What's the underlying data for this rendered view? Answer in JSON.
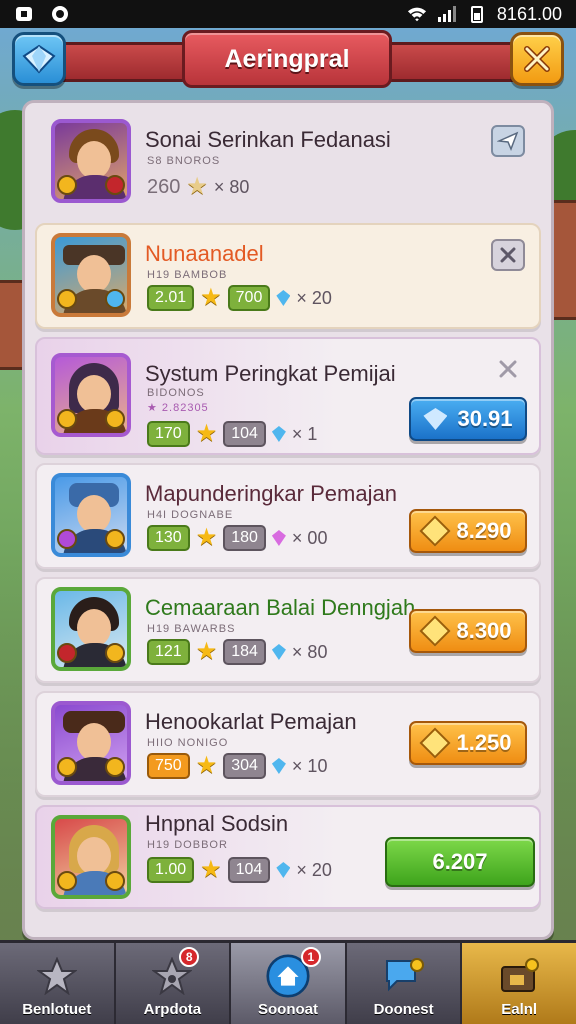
{
  "status_bar": {
    "time": "8161.00"
  },
  "header": {
    "title": "Aeringpral"
  },
  "rows": [
    {
      "name": "Sonai Serinkan Fedanasi",
      "sub": "S8 BNOROS",
      "stat1": "260",
      "mult": "× 80"
    },
    {
      "name": "Nunaanadel",
      "sub": "H19 BAMBOB",
      "stat1": "2.01",
      "stat2": "700",
      "mult": "× 20"
    },
    {
      "name": "Systum Peringkat Pemijai",
      "sub": "BIDONOS",
      "sub2": "★ 2.82305",
      "stat1": "170",
      "stat2": "104",
      "mult": "× 1",
      "price": "30.91"
    },
    {
      "name": "Mapunderingkar Pemajan",
      "sub": "H4I DOGNABE",
      "stat1": "130",
      "stat2": "180",
      "mult": "× 00",
      "price": "8.290"
    },
    {
      "name": "Cemaaraan Balai Denngjah",
      "sub": "H19 BAWARBS",
      "stat1": "121",
      "stat2": "184",
      "mult": "× 80",
      "price": "8.300"
    },
    {
      "name": "Henookarlat Pemajan",
      "sub": "HIIO NONIGO",
      "stat1": "750",
      "stat2": "304",
      "mult": "× 10",
      "price": "1.250"
    },
    {
      "name": "Hnpnal Sodsin",
      "sub": "H19 DOBBOR",
      "stat1": "1.00",
      "stat2": "104",
      "mult": "× 20",
      "price": "6.207"
    }
  ],
  "nav": [
    {
      "label": "Benlotuet"
    },
    {
      "label": "Arpdota",
      "badge": "8"
    },
    {
      "label": "Soonoat",
      "badge": "1"
    },
    {
      "label": "Doonest"
    },
    {
      "label": "Ealnl"
    }
  ]
}
